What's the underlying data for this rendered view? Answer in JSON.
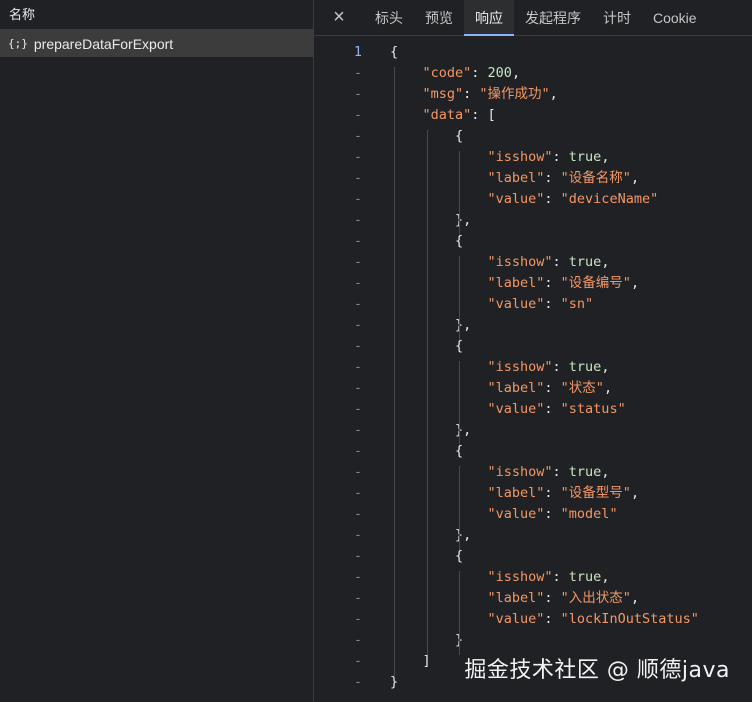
{
  "left_panel": {
    "header": "名称",
    "request": {
      "icon": "{;}",
      "name": "prepareDataForExport"
    }
  },
  "tabs": [
    {
      "label": "标头",
      "active": false
    },
    {
      "label": "预览",
      "active": false
    },
    {
      "label": "响应",
      "active": true
    },
    {
      "label": "发起程序",
      "active": false
    },
    {
      "label": "计时",
      "active": false
    },
    {
      "label": "Cookie",
      "active": false
    }
  ],
  "close_icon": "×",
  "watermark": "掘金技术社区 @ 顺德java",
  "response": {
    "code": 200,
    "msg": "操作成功",
    "data": [
      {
        "isshow": true,
        "label": "设备名称",
        "value": "deviceName"
      },
      {
        "isshow": true,
        "label": "设备编号",
        "value": "sn"
      },
      {
        "isshow": true,
        "label": "状态",
        "value": "status"
      },
      {
        "isshow": true,
        "label": "设备型号",
        "value": "model"
      },
      {
        "isshow": true,
        "label": "入出状态",
        "value": "lockInOutStatus"
      }
    ]
  },
  "gutter": {
    "first": "1",
    "rest": "-"
  },
  "colors": {
    "key": "#f29766",
    "string": "#f29766",
    "literal": "#c9e4c3",
    "active_tab": "#8ab4f8"
  }
}
